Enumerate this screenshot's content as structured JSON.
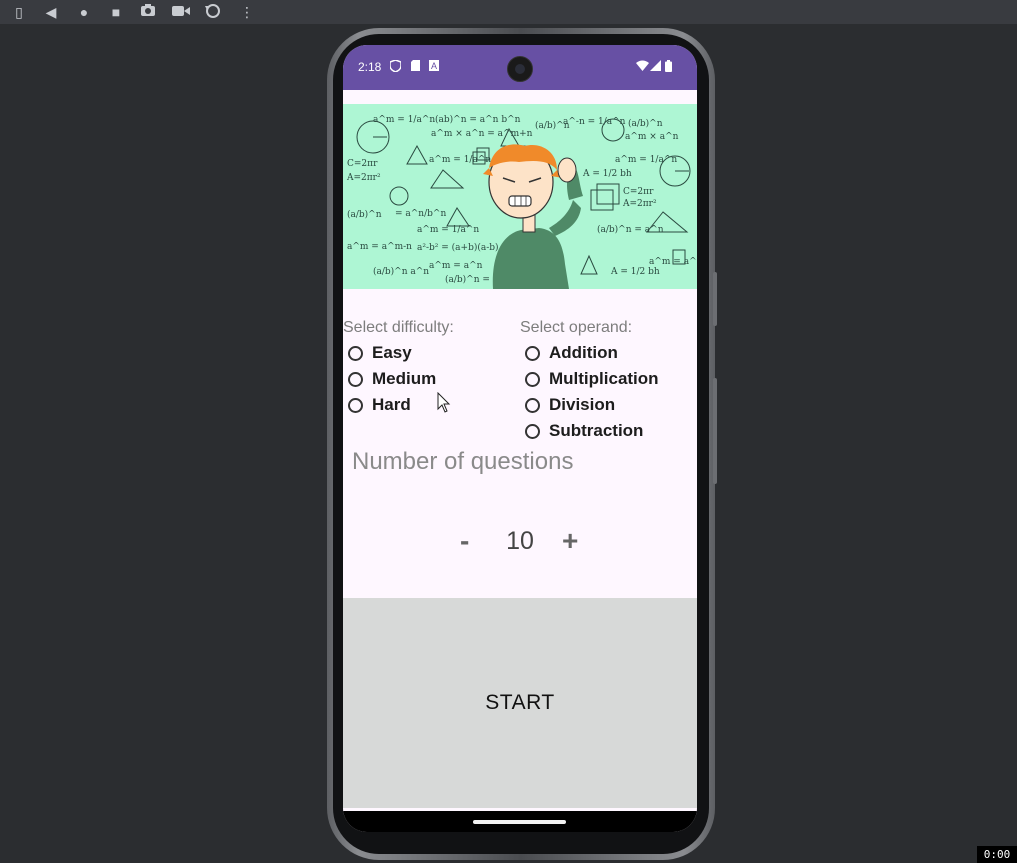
{
  "toolbar": {
    "icons": [
      "device-icon",
      "back-icon",
      "home-icon",
      "overview-icon",
      "camera-icon",
      "record-icon",
      "rotate-icon",
      "more-icon"
    ]
  },
  "status_bar": {
    "time": "2:18",
    "icons": [
      "shield-icon",
      "sd-card-icon",
      "a-icon",
      "wifi-icon",
      "signal-icon",
      "battery-icon"
    ],
    "background": "#6750a4"
  },
  "difficulty": {
    "label": "Select difficulty:",
    "options": [
      "Easy",
      "Medium",
      "Hard"
    ]
  },
  "operand": {
    "label": "Select operand:",
    "options": [
      "Addition",
      "Multiplication",
      "Division",
      "Subtraction"
    ]
  },
  "questions": {
    "label": "Number of questions",
    "minus": "-",
    "value": "10",
    "plus": "+"
  },
  "start_button": {
    "label": "START"
  },
  "colors": {
    "accent": "#6750a4",
    "hero_bg": "#aef6d4",
    "screen_bg": "#fef7ff",
    "start_bg": "#d7d9d8"
  },
  "overlay": {
    "timer": "0:00"
  }
}
